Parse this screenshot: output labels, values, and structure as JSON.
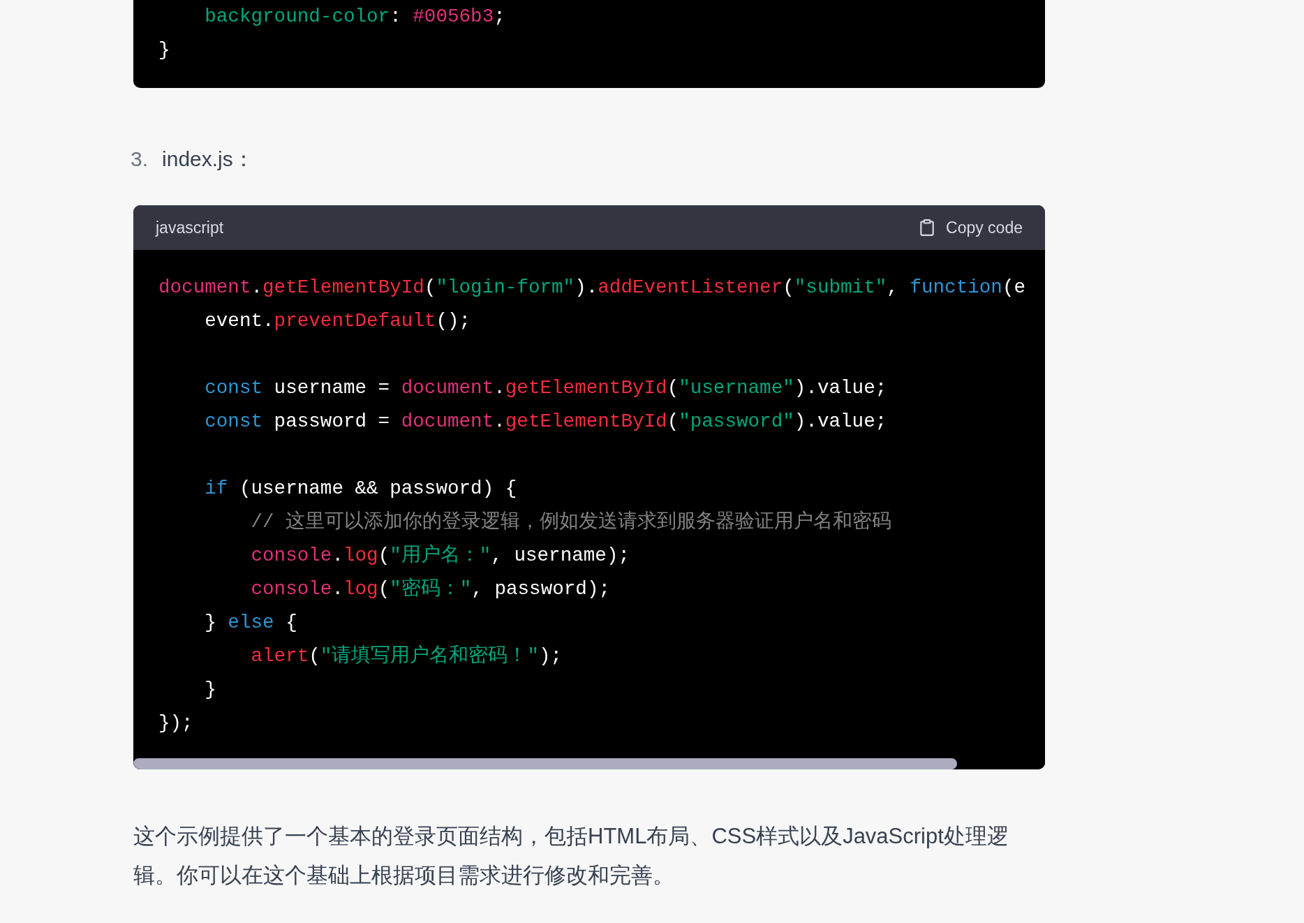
{
  "previous_code_block": {
    "lines": [
      {
        "kind": "code",
        "children": [
          {
            "kind": "code",
            "tokens": [
              {
                "kind": "string",
                "text": "background-color"
              },
              {
                "kind": "plain",
                "text": ": "
              },
              {
                "kind": "builtin",
                "text": "#0056b3"
              },
              {
                "kind": "plain",
                "text": ";"
              }
            ]
          }
        ]
      },
      {
        "kind": "code",
        "tokens": [
          {
            "kind": "plain",
            "text": "}"
          }
        ]
      }
    ]
  },
  "list_item": {
    "number": "3.",
    "text": "index.js："
  },
  "code_block": {
    "language": "javascript",
    "copy_button": "Copy code",
    "lines": [
      {
        "kind": "code",
        "tokens": [
          {
            "kind": "builtin",
            "text": "document"
          },
          {
            "kind": "plain",
            "text": "."
          },
          {
            "kind": "method",
            "text": "getElementById"
          },
          {
            "kind": "plain",
            "text": "("
          },
          {
            "kind": "string",
            "text": "\"login-form\""
          },
          {
            "kind": "plain",
            "text": ")."
          },
          {
            "kind": "method",
            "text": "addEventListener"
          },
          {
            "kind": "plain",
            "text": "("
          },
          {
            "kind": "string",
            "text": "\"submit\""
          },
          {
            "kind": "plain",
            "text": ", "
          },
          {
            "kind": "keyword",
            "text": "function"
          },
          {
            "kind": "plain",
            "text": "(e"
          }
        ],
        "children": [
          {
            "kind": "code",
            "tokens": [
              {
                "kind": "plain",
                "text": "event."
              },
              {
                "kind": "method",
                "text": "preventDefault"
              },
              {
                "kind": "plain",
                "text": "();"
              }
            ]
          },
          {
            "kind": "blank"
          },
          {
            "kind": "code",
            "tokens": [
              {
                "kind": "keyword",
                "text": "const"
              },
              {
                "kind": "plain",
                "text": " username = "
              },
              {
                "kind": "builtin",
                "text": "document"
              },
              {
                "kind": "plain",
                "text": "."
              },
              {
                "kind": "method",
                "text": "getElementById"
              },
              {
                "kind": "plain",
                "text": "("
              },
              {
                "kind": "string",
                "text": "\"username\""
              },
              {
                "kind": "plain",
                "text": ").value;"
              }
            ]
          },
          {
            "kind": "code",
            "tokens": [
              {
                "kind": "keyword",
                "text": "const"
              },
              {
                "kind": "plain",
                "text": " password = "
              },
              {
                "kind": "builtin",
                "text": "document"
              },
              {
                "kind": "plain",
                "text": "."
              },
              {
                "kind": "method",
                "text": "getElementById"
              },
              {
                "kind": "plain",
                "text": "("
              },
              {
                "kind": "string",
                "text": "\"password\""
              },
              {
                "kind": "plain",
                "text": ").value;"
              }
            ]
          },
          {
            "kind": "blank"
          },
          {
            "kind": "code",
            "tokens": [
              {
                "kind": "keyword",
                "text": "if"
              },
              {
                "kind": "plain",
                "text": " (username && password) {"
              }
            ],
            "children": [
              {
                "kind": "code",
                "tokens": [
                  {
                    "kind": "comment",
                    "text": "// 这里可以添加你的登录逻辑，例如发送请求到服务器验证用户名和密码"
                  }
                ]
              },
              {
                "kind": "code",
                "tokens": [
                  {
                    "kind": "builtin",
                    "text": "console"
                  },
                  {
                    "kind": "plain",
                    "text": "."
                  },
                  {
                    "kind": "method",
                    "text": "log"
                  },
                  {
                    "kind": "plain",
                    "text": "("
                  },
                  {
                    "kind": "string",
                    "text": "\"用户名：\""
                  },
                  {
                    "kind": "plain",
                    "text": ", username);"
                  }
                ]
              },
              {
                "kind": "code",
                "tokens": [
                  {
                    "kind": "builtin",
                    "text": "console"
                  },
                  {
                    "kind": "plain",
                    "text": "."
                  },
                  {
                    "kind": "method",
                    "text": "log"
                  },
                  {
                    "kind": "plain",
                    "text": "("
                  },
                  {
                    "kind": "string",
                    "text": "\"密码：\""
                  },
                  {
                    "kind": "plain",
                    "text": ", password);"
                  }
                ]
              }
            ]
          },
          {
            "kind": "code",
            "tokens": [
              {
                "kind": "plain",
                "text": "} "
              },
              {
                "kind": "keyword",
                "text": "else"
              },
              {
                "kind": "plain",
                "text": " {"
              }
            ],
            "children": [
              {
                "kind": "code",
                "tokens": [
                  {
                    "kind": "method",
                    "text": "alert"
                  },
                  {
                    "kind": "plain",
                    "text": "("
                  },
                  {
                    "kind": "string",
                    "text": "\"请填写用户名和密码！\""
                  },
                  {
                    "kind": "plain",
                    "text": ");"
                  }
                ]
              }
            ]
          },
          {
            "kind": "code",
            "tokens": [
              {
                "kind": "plain",
                "text": "}"
              }
            ]
          }
        ]
      },
      {
        "kind": "code",
        "tokens": [
          {
            "kind": "plain",
            "text": "});"
          }
        ]
      }
    ]
  },
  "paragraph": "这个示例提供了一个基本的登录页面结构，包括HTML布局、CSS样式以及JavaScript处理逻辑。你可以在这个基础上根据项目需求进行修改和完善。"
}
